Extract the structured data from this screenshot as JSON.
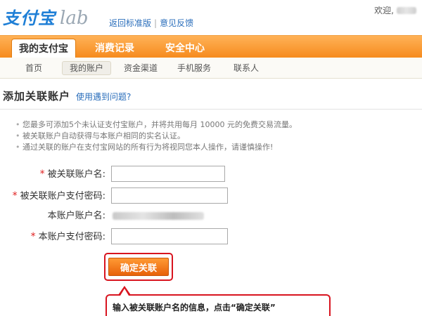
{
  "header": {
    "logo_text": "支付宝",
    "logo_suffix": "lab",
    "back_link": "返回标准版",
    "separator": "|",
    "feedback_link": "意见反馈",
    "welcome": "欢迎,"
  },
  "main_nav": {
    "tabs": [
      {
        "label": "我的支付宝"
      },
      {
        "label": "消费记录"
      },
      {
        "label": "安全中心"
      }
    ]
  },
  "sub_nav": {
    "items": [
      {
        "label": "首页"
      },
      {
        "label": "我的账户"
      },
      {
        "label": "资金渠道"
      },
      {
        "label": "手机服务"
      },
      {
        "label": "联系人"
      }
    ]
  },
  "page": {
    "title": "添加关联账户",
    "help_link": "使用遇到问题?"
  },
  "notes": [
    "您最多可添加5个未认证支付宝账户，并将共用每月 10000 元的免费交易流量。",
    "被关联账户自动获得与本账户相同的实名认证。",
    "通过关联的账户在支付宝网站的所有行为将视同您本人操作，请谨慎操作!"
  ],
  "form": {
    "required_mark": "*",
    "linked_account_label": "被关联账户名:",
    "linked_password_label": "被关联账户支付密码:",
    "this_account_label": "本账户账户名:",
    "this_password_label": "本账户支付密码:",
    "confirm_label": "确定关联"
  },
  "callout": {
    "text": "输入被关联账户名的信息，点击“确定关联”"
  },
  "colors": {
    "nav_orange": "#f68b1e",
    "link_blue": "#2a6ebb",
    "highlight_red": "#d8141f"
  }
}
